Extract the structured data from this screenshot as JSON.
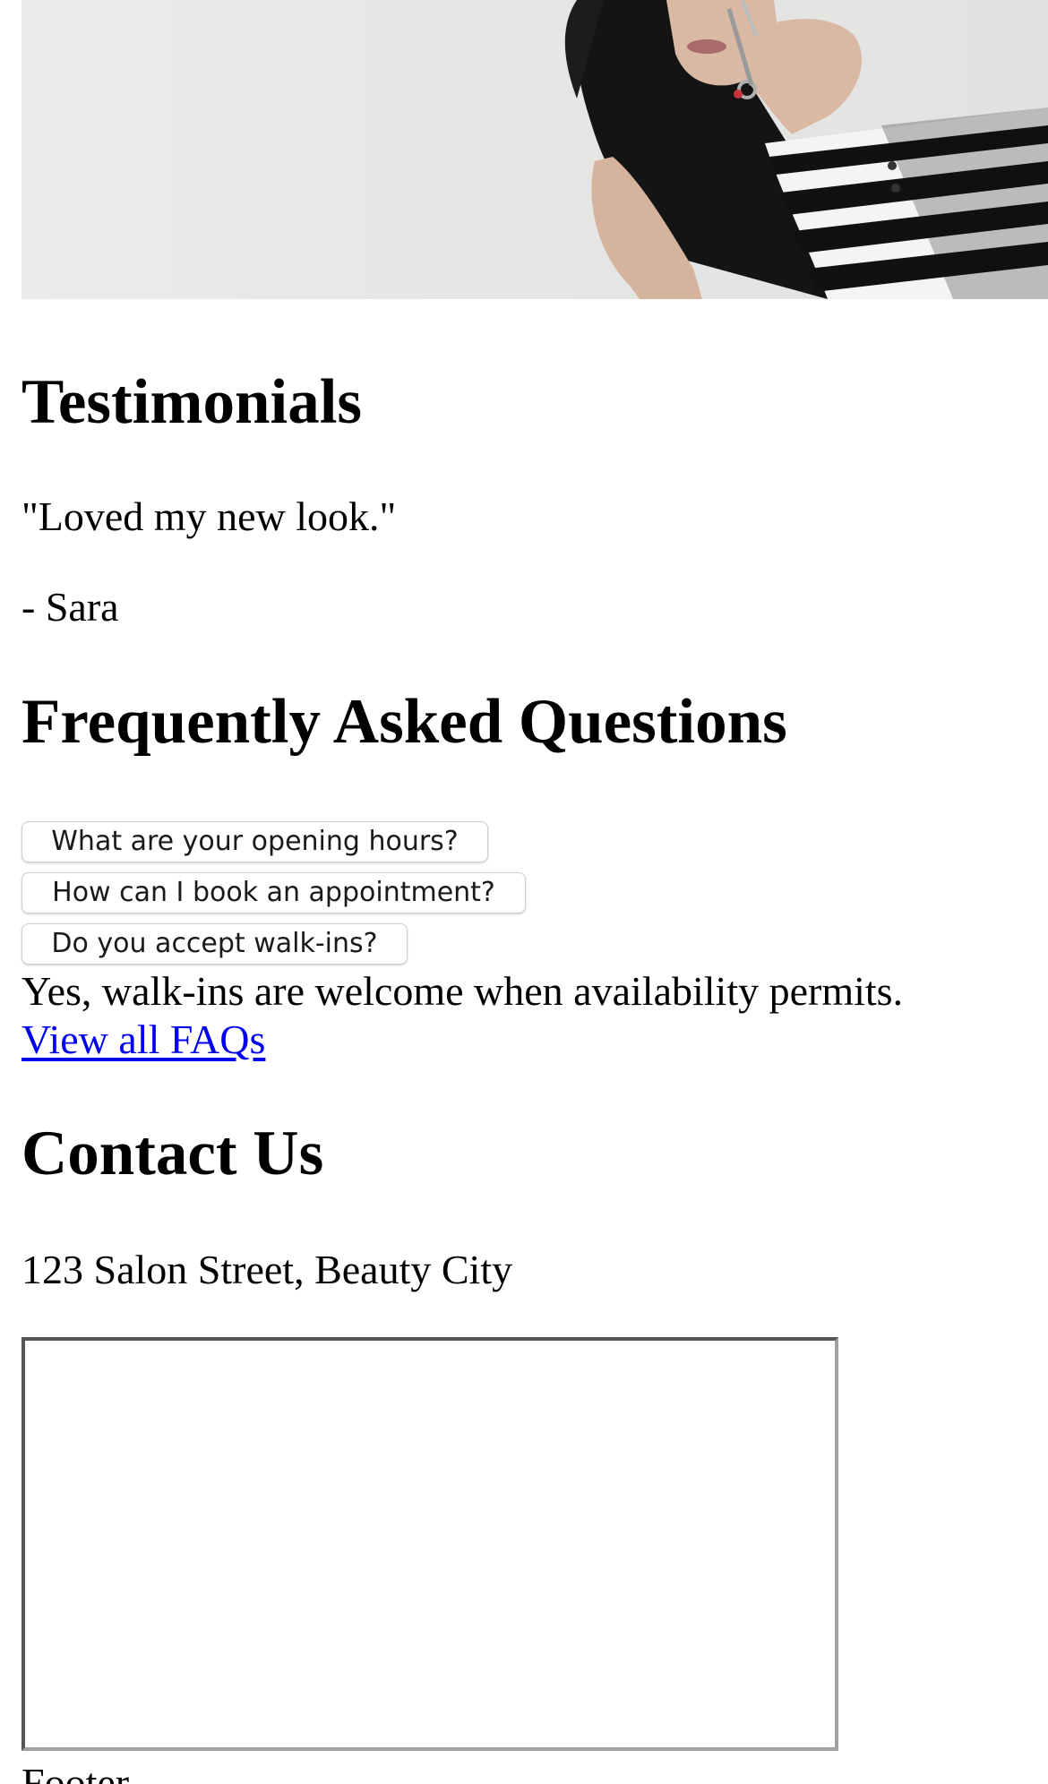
{
  "hero": {
    "image": "salon-hero-photo-woman-with-scissors"
  },
  "testimonials": {
    "heading": "Testimonials",
    "quote": "\"Loved my new look.\"",
    "author": "- Sara"
  },
  "faq": {
    "heading": "Frequently Asked Questions",
    "questions": [
      "What are your opening hours?",
      "How can I book an appointment?",
      "Do you accept walk-ins?"
    ],
    "answer": "Yes, walk-ins are welcome when availability permits.",
    "link": "View all FAQs"
  },
  "contact": {
    "heading": "Contact Us",
    "address": "123 Salon Street, Beauty City"
  },
  "footer": {
    "text": "Footer"
  },
  "colors": {
    "link": "#0000ee",
    "text": "#000000",
    "background": "#ffffff"
  }
}
